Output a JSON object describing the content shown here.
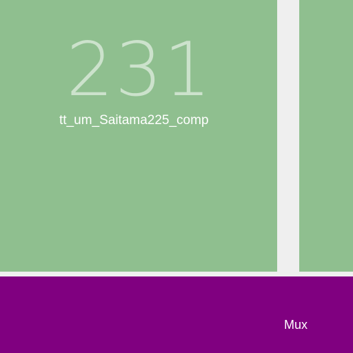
{
  "tiles": {
    "main": {
      "count": "231",
      "label": "tt_um_Saitama225_comp",
      "color": "#8fbf8f"
    },
    "side": {
      "color": "#8fbf8f"
    },
    "bottom": {
      "label": "Mux",
      "color": "#800080"
    }
  },
  "colors": {
    "background": "#efefef",
    "text": "#ffffff"
  }
}
